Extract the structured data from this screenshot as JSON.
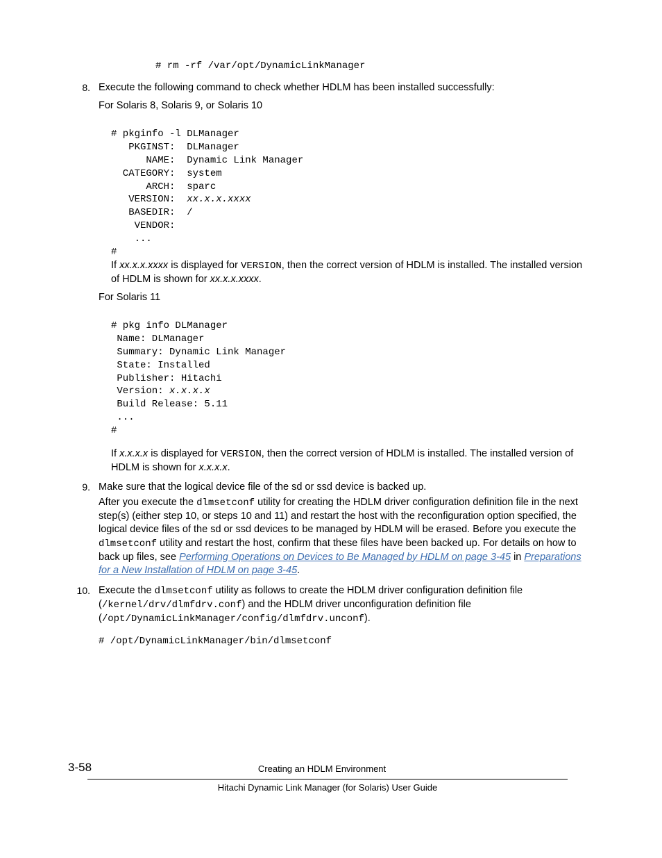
{
  "code_block_rm": "# rm -rf /var/opt/DynamicLinkManager",
  "step8": {
    "num": "8.",
    "intro": "Execute the following command to check whether HDLM has been installed successfully:",
    "for_solaris_10_label": "For Solaris 8, Solaris 9, or Solaris 10",
    "code10_pre": "# pkginfo -l DLManager\n   PKGINST:  DLManager\n      NAME:  Dynamic Link Manager\n  CATEGORY:  system\n      ARCH:  sparc\n   VERSION:  ",
    "code10_var": "xx.x.x.xxxx",
    "code10_post": "\n   BASEDIR:  /\n    VENDOR:\n    ...\n#",
    "para10_pre": "If ",
    "para10_var1": "xx.x.x.xxxx",
    "para10_mid1": " is displayed for ",
    "para10_version": "VERSION",
    "para10_mid2": ", then the correct version of HDLM is installed. The installed version of HDLM is shown for ",
    "para10_var2": "xx.x.x.xxxx",
    "para10_end": ".",
    "for_solaris_11_label": "For Solaris 11",
    "code11_pre": "# pkg info DLManager\n Name: DLManager\n Summary: Dynamic Link Manager\n State: Installed\n Publisher: Hitachi\n Version: ",
    "code11_var": "x.x.x.x",
    "code11_post": "\n Build Release: 5.11\n ...\n#",
    "para11_pre": "If ",
    "para11_var1": "x.x.x.x",
    "para11_mid1": " is displayed for ",
    "para11_version": "VERSION",
    "para11_mid2": ", then the correct version of HDLM is installed. The installed version of HDLM is shown for ",
    "para11_var2": "x.x.x.x",
    "para11_end": "."
  },
  "step9": {
    "num": "9.",
    "line1": "Make sure that the logical device file of the sd or ssd device is backed up.",
    "para_pre": "After you execute the ",
    "para_mono1": "dlmsetconf",
    "para_mid1": " utility for creating the HDLM driver configuration definition file in the next step(s) (either step 10, or steps 10 and 11) and restart the host with the reconfiguration option specified, the logical device files of the sd or ssd devices to be managed by HDLM will be erased. Before you execute the ",
    "para_mono2": "dlmsetconf",
    "para_mid2": " utility and restart the host, confirm that these files have been backed up. For details on how to back up files, see ",
    "link1": "Performing Operations on Devices to Be Managed by HDLM on page 3-45",
    "para_mid3": " in ",
    "link2": "Preparations for a New Installation of HDLM on page 3-45",
    "para_end": "."
  },
  "step10": {
    "num": "10.",
    "para_pre": "Execute the ",
    "para_mono1": "dlmsetconf",
    "para_mid1": " utility as follows to create the HDLM driver configuration definition file (",
    "para_mono2": "/kernel/drv/dlmfdrv.conf",
    "para_mid2": ") and the HDLM driver unconfiguration definition file (",
    "para_mono3": "/opt/DynamicLinkManager/config/dlmfdrv.unconf",
    "para_end": ").",
    "code": "# /opt/DynamicLinkManager/bin/dlmsetconf"
  },
  "footer": {
    "page_num": "3-58",
    "title1": "Creating an HDLM Environment",
    "title2": "Hitachi Dynamic Link Manager (for Solaris) User Guide"
  }
}
